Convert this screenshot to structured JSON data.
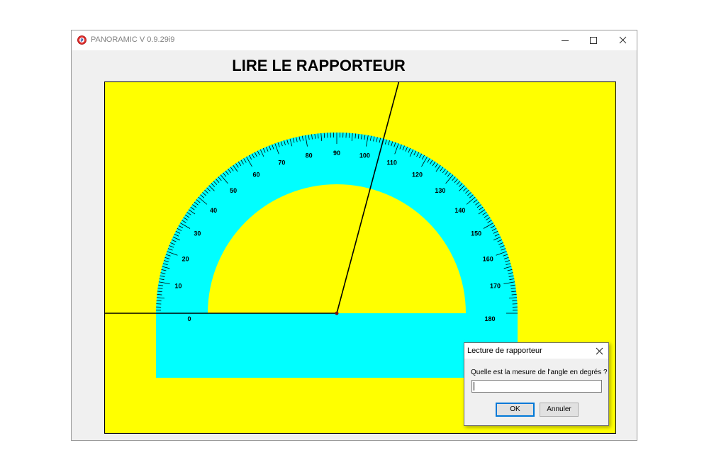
{
  "window": {
    "title": "PANORAMIC V 0.9.29i9",
    "icon": "panoramic-app-icon",
    "controls": [
      "minimize-icon",
      "maximize-icon",
      "close-icon"
    ]
  },
  "heading": "LIRE LE RAPPORTEUR",
  "protractor": {
    "labels_left": [
      "0",
      "10",
      "20",
      "30",
      "40",
      "50",
      "60",
      "70",
      "80",
      "90",
      "100",
      "110",
      "120",
      "130",
      "140",
      "150",
      "160",
      "170",
      "180"
    ],
    "labels_right": [
      "180",
      "170",
      "160",
      "150",
      "140",
      "130",
      "120",
      "110",
      "100",
      "90",
      "80",
      "70",
      "60",
      "50",
      "40",
      "30",
      "20",
      "10",
      "0"
    ],
    "angle_line_degrees": 105,
    "colors": {
      "background": "#ffff00",
      "protractor": "#00ffff",
      "ink": "#000000"
    }
  },
  "dialog": {
    "title": "Lecture de rapporteur",
    "prompt": "Quelle est la mesure de l'angle en degrés ?",
    "input_value": "",
    "ok_label": "OK",
    "cancel_label": "Annuler"
  }
}
